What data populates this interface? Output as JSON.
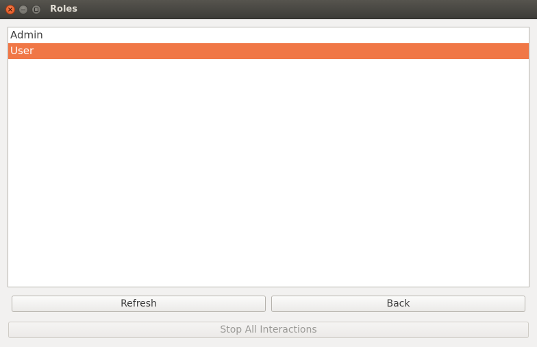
{
  "window": {
    "title": "Roles",
    "buttons": {
      "close_icon": "close-icon",
      "minimize_icon": "minimize-icon",
      "maximize_icon": "maximize-icon"
    }
  },
  "roles_list": {
    "items": [
      {
        "label": "Admin",
        "selected": false
      },
      {
        "label": "User",
        "selected": true
      }
    ],
    "selection_color": "#f07746"
  },
  "actions": {
    "refresh_label": "Refresh",
    "back_label": "Back",
    "stop_label": "Stop All Interactions",
    "stop_enabled": false
  }
}
